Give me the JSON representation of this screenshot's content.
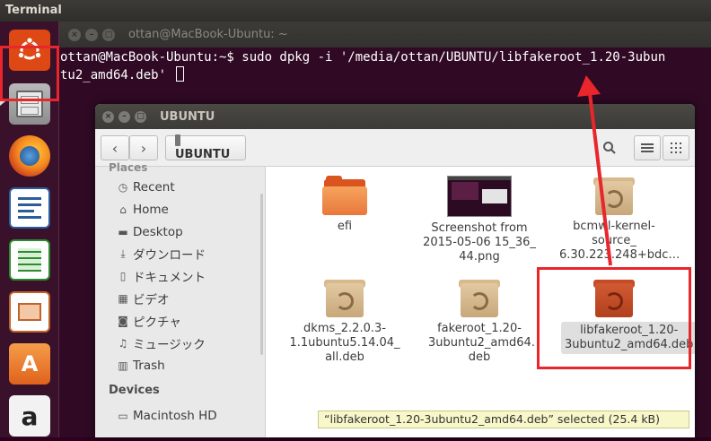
{
  "top_panel": {
    "app_name": "Terminal"
  },
  "launcher": {
    "items": [
      {
        "name": "dash",
        "icon": "ubuntu-logo-icon"
      },
      {
        "name": "files",
        "icon": "file-cabinet-icon"
      },
      {
        "name": "firefox",
        "icon": "firefox-icon"
      },
      {
        "name": "writer",
        "icon": "writer-icon"
      },
      {
        "name": "calc",
        "icon": "calc-icon"
      },
      {
        "name": "impress",
        "icon": "impress-icon"
      },
      {
        "name": "software-center",
        "icon": "shopping-bag-icon",
        "glyph": "A"
      },
      {
        "name": "amazon",
        "icon": "amazon-icon",
        "glyph": "a"
      }
    ]
  },
  "terminal": {
    "title": "ottan@MacBook-Ubuntu: ~",
    "line1": "ottan@MacBook-Ubuntu:~$ sudo dpkg -i '/media/ottan/UBUNTU/libfakeroot_1.20-3ubun",
    "line2": "tu2_amd64.deb' "
  },
  "file_manager": {
    "title": "UBUNTU",
    "breadcrumb": "UBUNTU",
    "sidebar": {
      "places_header_cut": "Places",
      "items": [
        {
          "label": "Recent",
          "icon": "clock-icon",
          "glyph": "◷"
        },
        {
          "label": "Home",
          "icon": "home-icon",
          "glyph": "⌂"
        },
        {
          "label": "Desktop",
          "icon": "folder-icon",
          "glyph": "▬"
        },
        {
          "label": "ダウンロード",
          "icon": "download-icon",
          "glyph": "⤓"
        },
        {
          "label": "ドキュメント",
          "icon": "document-icon",
          "glyph": "▯"
        },
        {
          "label": "ビデオ",
          "icon": "video-icon",
          "glyph": "▦"
        },
        {
          "label": "ピクチャ",
          "icon": "camera-icon",
          "glyph": "◙"
        },
        {
          "label": "ミュージック",
          "icon": "music-icon",
          "glyph": "♫"
        },
        {
          "label": "Trash",
          "icon": "trash-icon",
          "glyph": "▥"
        }
      ],
      "devices_header": "Devices",
      "devices": [
        {
          "label": "Macintosh HD",
          "icon": "drive-icon",
          "glyph": "▭"
        }
      ]
    },
    "files": [
      {
        "label": "efi",
        "icon": "folder"
      },
      {
        "label": "Screenshot from 2015-05-06 15_36_ 44.png",
        "icon": "image"
      },
      {
        "label": "bcmwl-kernel-source_ 6.30.223.248+bdc…",
        "icon": "package"
      },
      {
        "label": "dkms_2.2.0.3-1.1ubuntu5.14.04_ all.deb",
        "icon": "package"
      },
      {
        "label": "fakeroot_1.20-3ubuntu2_amd64. deb",
        "icon": "package"
      },
      {
        "label": "libfakeroot_1.20-3ubuntu2_amd64.deb",
        "icon": "package-selected"
      }
    ],
    "status": "“libfakeroot_1.20-3ubuntu2_amd64.deb” selected  (25.4 kB)"
  },
  "annotation": {
    "color": "#e8262c"
  }
}
